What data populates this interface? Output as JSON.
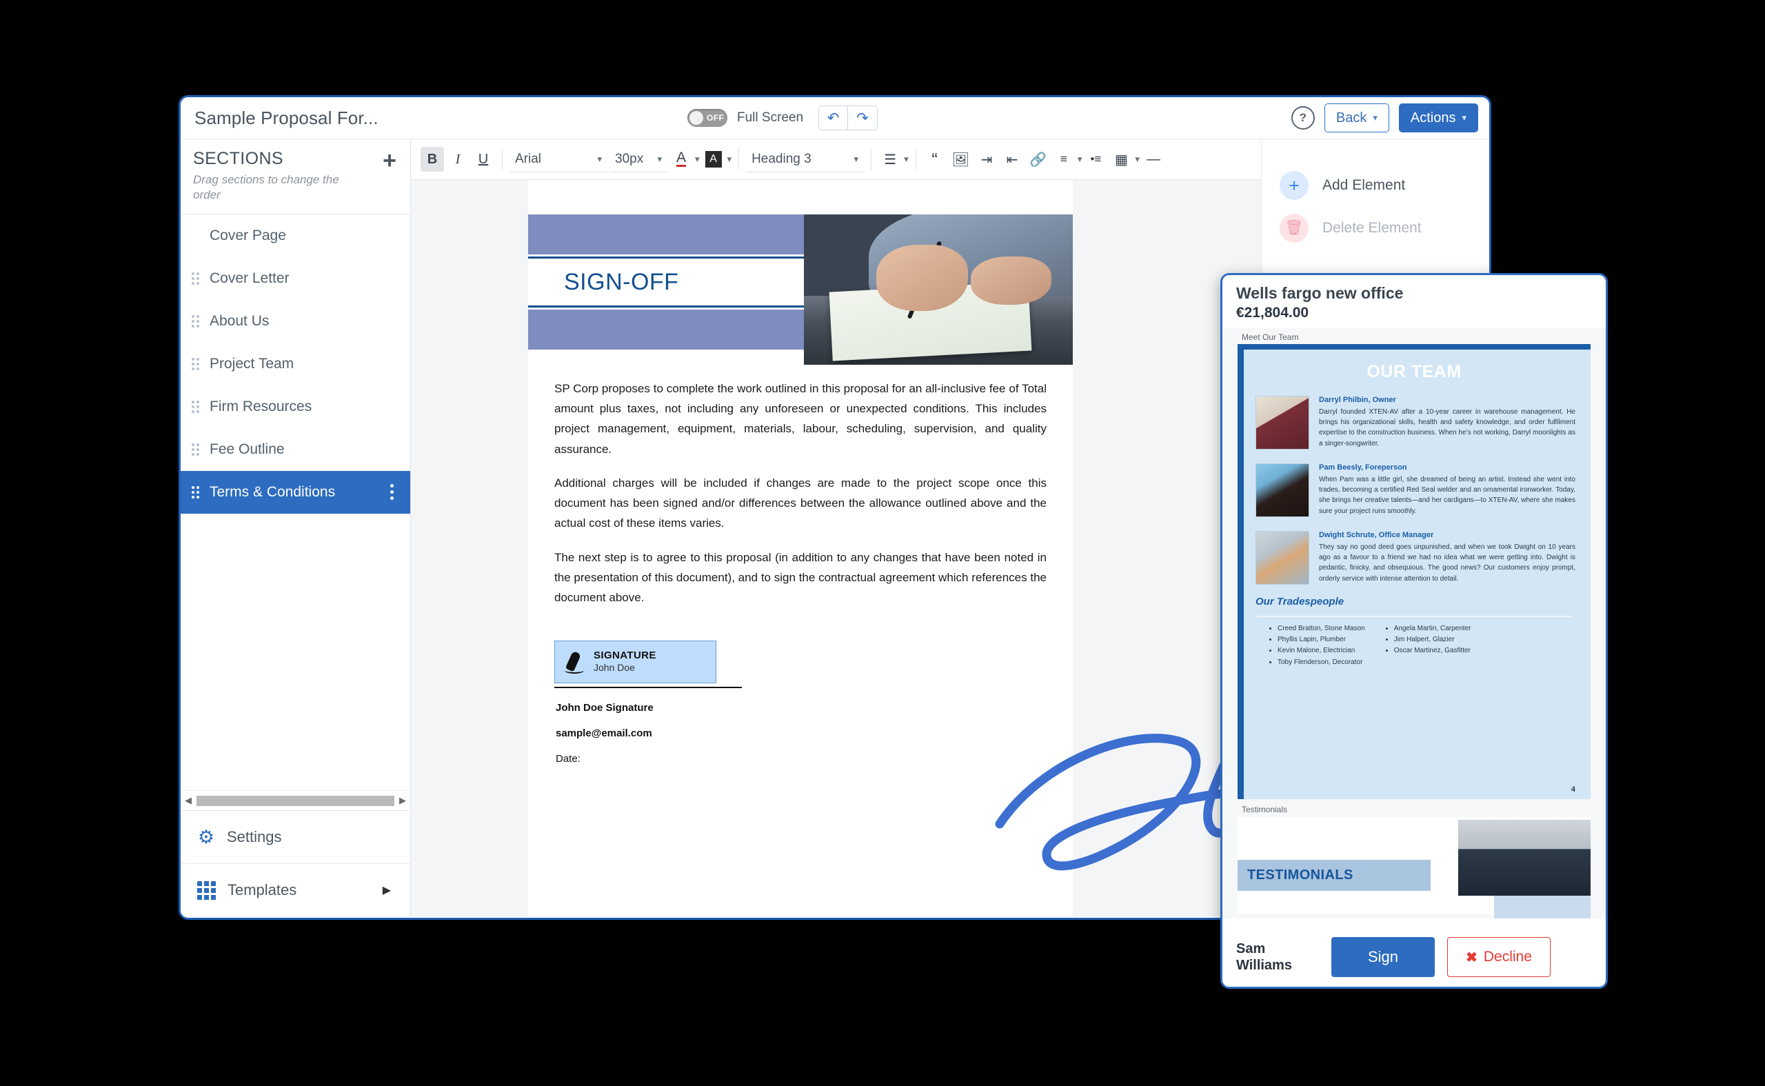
{
  "header": {
    "doc_title": "Sample Proposal For...",
    "fullscreen_toggle": "OFF",
    "fullscreen_label": "Full Screen",
    "undo_icon": "undo-icon",
    "redo_icon": "redo-icon",
    "help_label": "?",
    "back_label": "Back",
    "actions_label": "Actions"
  },
  "sidebar": {
    "title": "SECTIONS",
    "subtitle": "Drag sections to change the order",
    "add_label": "+",
    "items": [
      {
        "label": "Cover Page",
        "draggable": false
      },
      {
        "label": "Cover Letter",
        "draggable": true
      },
      {
        "label": "About Us",
        "draggable": true
      },
      {
        "label": "Project Team",
        "draggable": true
      },
      {
        "label": "Firm Resources",
        "draggable": true
      },
      {
        "label": "Fee Outline",
        "draggable": true
      },
      {
        "label": "Terms & Conditions",
        "draggable": true,
        "active": true
      }
    ],
    "settings_label": "Settings",
    "templates_label": "Templates"
  },
  "toolbar": {
    "bold": "B",
    "italic": "I",
    "underline": "U",
    "font_family": "Arial",
    "font_size": "30px",
    "text_color_icon": "text-color-icon",
    "highlight_icon": "highlight-color-icon",
    "heading": "Heading 3",
    "align_icon": "align-left-icon",
    "quote_icon": "blockquote-icon",
    "image_icon": "insert-image-icon",
    "indent_icon": "indent-increase-icon",
    "outdent_icon": "indent-decrease-icon",
    "link_icon": "link-icon",
    "ordered_list_icon": "ordered-list-icon",
    "unordered_list_icon": "unordered-list-icon",
    "table_icon": "table-icon",
    "hr_icon": "horizontal-rule-icon"
  },
  "document": {
    "banner_title": "SIGN-OFF",
    "paragraphs": [
      "SP Corp proposes to complete the work outlined in this proposal for an all-inclusive fee of Total amount plus taxes, not including any unforeseen or unexpected conditions. This includes project management, equipment, materials, labour, scheduling, supervision, and quality assurance.",
      "Additional charges will be included if changes are made to the project scope once this document has been signed and/or differences between the allowance outlined above and the actual cost of these items varies.",
      "The next step is to agree to this proposal (in addition to any changes that have been noted in the presentation of this document), and to sign the contractual agreement which references the document above."
    ],
    "signature_chip_title": "SIGNATURE",
    "signature_chip_name": "John Doe",
    "signature_name_line": "John Doe Signature",
    "signature_email": "sample@email.com",
    "signature_date_label": "Date:"
  },
  "element_panel": {
    "add_label": "Add Element",
    "delete_label": "Delete Element"
  },
  "preview": {
    "title": "Wells fargo new office",
    "amount": "€21,804.00",
    "section_label": "Meet Our Team",
    "page_heading": "OUR TEAM",
    "bios": [
      {
        "name": "Darryl Philbin, Owner",
        "text": "Darryl founded XTEN-AV after a 10-year career in warehouse management. He brings his organizational skills, health and safety knowledge, and order fulfilment expertise to the construction business. When he’s not working, Darryl moonlights as a singer-songwriter."
      },
      {
        "name": "Pam Beesly, Foreperson",
        "text": "When Pam was a little girl, she dreamed of being an artist. Instead she went into trades, becoming a certified Red Seal welder and an ornamental ironworker. Today, she brings her creative talents—and her cardigans—to XTEN-AV, where she makes sure your project runs smoothly."
      },
      {
        "name": "Dwight Schrute, Office Manager",
        "text": "They say no good deed goes unpunished, and when we took Dwight on 10 years ago as a favour to a friend we had no idea what we were getting into. Dwight is pedantic, finicky, and obsequious. The good news? Our customers enjoy prompt, orderly service with intense attention to detail."
      }
    ],
    "tradespeople_heading": "Our Tradespeople",
    "tradespeople_col1": [
      "Creed Bratton, Stone Mason",
      "Phyllis Lapin, Plumber",
      "Kevin Malone, Electrician",
      "Toby Flenderson, Decorator"
    ],
    "tradespeople_col2": [
      "Angela Martin, Carpenter",
      "Jim Halpert, Glazier",
      "Oscar Martinez, Gasfitter"
    ],
    "page_number": "4",
    "testimonials_label": "Testimonials",
    "testimonials_heading": "TESTIMONIALS",
    "signer_name_line1": "Sam",
    "signer_name_line2": "Williams",
    "sign_label": "Sign",
    "decline_label": "Decline"
  },
  "colors": {
    "accent": "#2d6cc0",
    "danger": "#e53935",
    "banner": "#7f8cc0",
    "heading_blue": "#12508f"
  }
}
